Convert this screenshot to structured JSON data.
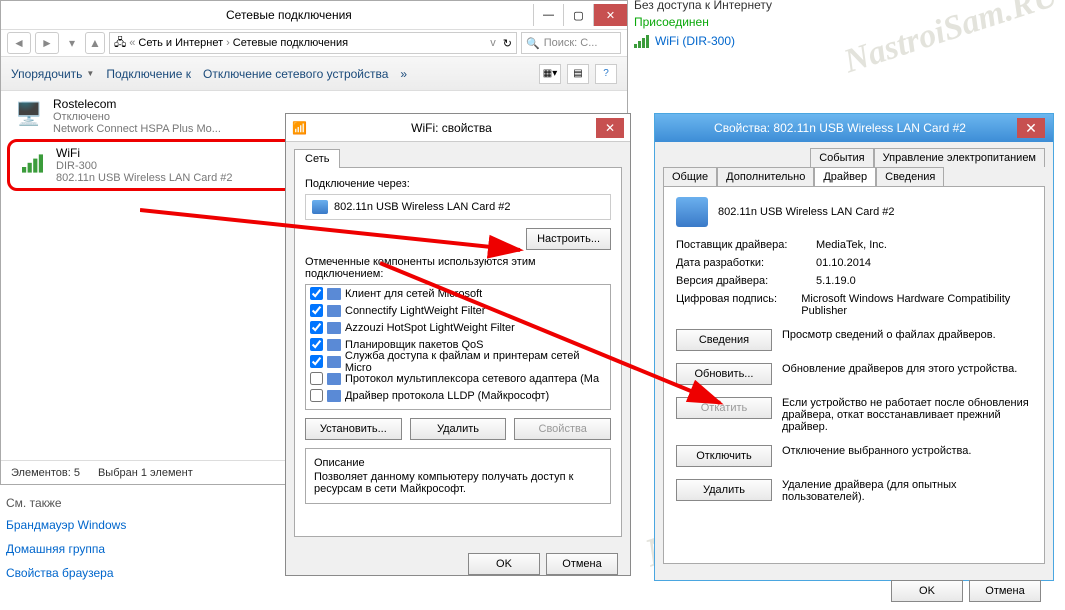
{
  "nc": {
    "title": "Сетевые подключения",
    "breadcrumb": {
      "l1": "Сеть и Интернет",
      "l2": "Сетевые подключения"
    },
    "search_placeholder": "Поиск: С...",
    "toolbar": {
      "organize": "Упорядочить",
      "connect": "Подключение к",
      "disable": "Отключение сетевого устройства"
    },
    "items": [
      {
        "name": "Rostelecom",
        "status": "Отключено",
        "device": "Network Connect HSPA Plus Mo..."
      },
      {
        "name": "WiFi",
        "status": "DIR-300",
        "device": "802.11n USB Wireless LAN Card #2"
      }
    ],
    "status": {
      "count": "Элементов: 5",
      "selected": "Выбран 1 элемент"
    }
  },
  "links": {
    "hdr": "См. также",
    "a1": "Брандмауэр Windows",
    "a2": "Домашняя группа",
    "a3": "Свойства браузера"
  },
  "wifi": {
    "title": "WiFi: свойства",
    "tab": "Сеть",
    "connect_lbl": "Подключение через:",
    "adapter": "802.11n USB Wireless LAN Card #2",
    "configure_btn": "Настроить...",
    "components_lbl": "Отмеченные компоненты используются этим подключением:",
    "components": [
      {
        "checked": true,
        "label": "Клиент для сетей Microsoft"
      },
      {
        "checked": true,
        "label": "Connectify LightWeight Filter"
      },
      {
        "checked": true,
        "label": "Azzouzi HotSpot LightWeight Filter"
      },
      {
        "checked": true,
        "label": "Планировщик пакетов QoS"
      },
      {
        "checked": true,
        "label": "Служба доступа к файлам и принтерам сетей Micro"
      },
      {
        "checked": false,
        "label": "Протокол мультиплексора сетевого адаптера (Ма"
      },
      {
        "checked": false,
        "label": "Драйвер протокола LLDP (Майкрософт)"
      }
    ],
    "btn_install": "Установить...",
    "btn_remove": "Удалить",
    "btn_props": "Свойства",
    "desc_hdr": "Описание",
    "desc_txt": "Позволяет данному компьютеру получать доступ к ресурсам в сети Майкрософт.",
    "ok": "OK",
    "cancel": "Отмена"
  },
  "drv": {
    "title": "Свойства: 802.11n USB Wireless LAN Card #2",
    "tabs_row1": [
      "События",
      "Управление электропитанием"
    ],
    "tabs_row2": [
      "Общие",
      "Дополнительно",
      "Драйвер",
      "Сведения"
    ],
    "active_tab": "Драйвер",
    "device": "802.11n USB Wireless LAN Card #2",
    "info": {
      "vendor_k": "Поставщик драйвера:",
      "vendor_v": "MediaTek, Inc.",
      "date_k": "Дата разработки:",
      "date_v": "01.10.2014",
      "ver_k": "Версия драйвера:",
      "ver_v": "5.1.19.0",
      "sig_k": "Цифровая подпись:",
      "sig_v": "Microsoft Windows Hardware Compatibility Publisher"
    },
    "actions": {
      "details_btn": "Сведения",
      "details_txt": "Просмотр сведений о файлах драйверов.",
      "update_btn": "Обновить...",
      "update_txt": "Обновление драйверов для этого устройства.",
      "rollback_btn": "Откатить",
      "rollback_txt": "Если устройство не работает после обновления драйвера, откат восстанавливает прежний драйвер.",
      "disable_btn": "Отключить",
      "disable_txt": "Отключение выбранного устройства.",
      "delete_btn": "Удалить",
      "delete_txt": "Удаление драйвера (для опытных пользователей)."
    },
    "ok": "OK",
    "cancel": "Отмена"
  },
  "netstat": {
    "l1": "Без доступа к Интернету",
    "l2": "Присоединен",
    "l3": "WiFi (DIR-300)"
  },
  "watermark": "NastroiSam.RU"
}
